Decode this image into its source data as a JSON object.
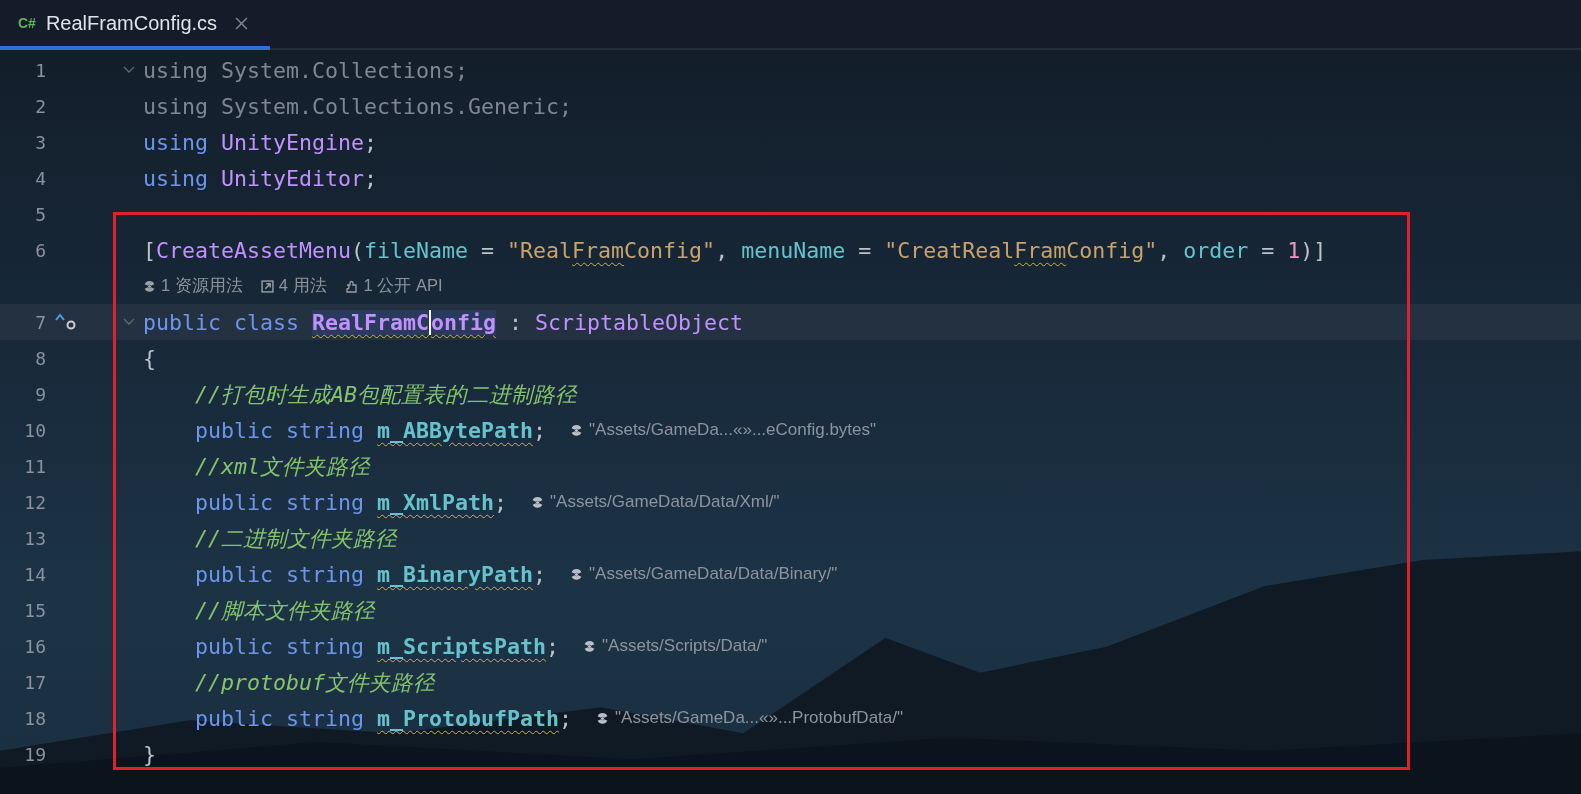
{
  "tabs": [
    {
      "lang": "C#",
      "label": "RealFramConfig.cs",
      "selected": true
    }
  ],
  "lines": [
    {
      "number": "1",
      "foldable": true,
      "framed": false,
      "current": false,
      "gutter_icons": false,
      "tokens": [
        {
          "text": "using System.Collections;",
          "kind": "dim"
        }
      ]
    },
    {
      "number": "2",
      "foldable": false,
      "framed": false,
      "current": false,
      "gutter_icons": false,
      "tokens": [
        {
          "text": "using System.Collections.Generic;",
          "kind": "dim"
        }
      ]
    },
    {
      "number": "3",
      "foldable": false,
      "framed": false,
      "current": false,
      "gutter_icons": false,
      "tokens": [
        {
          "text": "using",
          "kind": "kw"
        },
        {
          "text": " UnityEngine",
          "kind": "type"
        },
        {
          "text": ";",
          "kind": "plain"
        }
      ]
    },
    {
      "number": "4",
      "foldable": false,
      "framed": false,
      "current": false,
      "gutter_icons": false,
      "tokens": [
        {
          "text": "using",
          "kind": "kw"
        },
        {
          "text": " UnityEditor",
          "kind": "type"
        },
        {
          "text": ";",
          "kind": "plain"
        }
      ]
    },
    {
      "number": "5",
      "foldable": false,
      "framed": false,
      "current": false,
      "gutter_icons": false
    },
    {
      "number": "6",
      "foldable": false,
      "framed": true,
      "current": false,
      "gutter_icons": false,
      "tokens": [
        {
          "text": "[",
          "kind": "plain"
        },
        {
          "text": "CreateAssetMenu",
          "kind": "type"
        },
        {
          "text": "(",
          "kind": "plain"
        },
        {
          "text": "fileName",
          "kind": "param"
        },
        {
          "text": " = ",
          "kind": "plain"
        },
        {
          "text": "\"Real",
          "kind": "str"
        },
        {
          "text": "Fram",
          "kind": "str",
          "typo": true
        },
        {
          "text": "Config\"",
          "kind": "str"
        },
        {
          "text": ", ",
          "kind": "plain"
        },
        {
          "text": "menuName",
          "kind": "param"
        },
        {
          "text": " = ",
          "kind": "plain"
        },
        {
          "text": "\"CreatReal",
          "kind": "str"
        },
        {
          "text": "Fram",
          "kind": "str",
          "typo": true
        },
        {
          "text": "Config\"",
          "kind": "str"
        },
        {
          "text": ", ",
          "kind": "plain"
        },
        {
          "text": "order",
          "kind": "param"
        },
        {
          "text": " = ",
          "kind": "plain"
        },
        {
          "text": "1",
          "kind": "num"
        },
        {
          "text": ")]",
          "kind": "plain"
        }
      ],
      "lens": [
        {
          "kind": "resource",
          "text": "1 资源用法"
        },
        {
          "kind": "usages",
          "text": "4 用法"
        },
        {
          "kind": "api",
          "text": "1 公开 API"
        }
      ]
    },
    {
      "number": "7",
      "foldable": true,
      "framed": true,
      "current": true,
      "gutter_icons": true,
      "tokens": [
        {
          "text": "public",
          "kind": "kw"
        },
        {
          "text": " class ",
          "kind": "kw"
        },
        {
          "text": "RealFramC",
          "kind": "cls",
          "typo": true,
          "highlighted": true,
          "caret": true
        },
        {
          "text": "onfig",
          "kind": "cls",
          "typo": true,
          "highlighted": true
        },
        {
          "text": " : ",
          "kind": "plain"
        },
        {
          "text": "ScriptableObject",
          "kind": "type"
        }
      ]
    },
    {
      "number": "8",
      "foldable": false,
      "framed": true,
      "current": false,
      "gutter_icons": false,
      "tokens": [
        {
          "text": "{",
          "kind": "plain"
        }
      ]
    },
    {
      "number": "9",
      "foldable": false,
      "framed": true,
      "current": false,
      "gutter_icons": false,
      "tokens": [
        {
          "text": "    //打包时生成AB包配置表的二进制路径",
          "kind": "cm"
        }
      ]
    },
    {
      "number": "10",
      "foldable": false,
      "framed": true,
      "current": false,
      "gutter_icons": false,
      "tokens": [
        {
          "text": "    public string ",
          "kind": "kw"
        },
        {
          "text": "m_ABBytePath",
          "kind": "field",
          "typo": true
        },
        {
          "text": ";",
          "kind": "plain"
        }
      ],
      "hint": "\"Assets/GameDa...«»...eConfig.bytes\""
    },
    {
      "number": "11",
      "foldable": false,
      "framed": true,
      "current": false,
      "gutter_icons": false,
      "tokens": [
        {
          "text": "    //xml文件夹路径",
          "kind": "cm"
        }
      ]
    },
    {
      "number": "12",
      "foldable": false,
      "framed": true,
      "current": false,
      "gutter_icons": false,
      "tokens": [
        {
          "text": "    public string ",
          "kind": "kw"
        },
        {
          "text": "m_XmlPath",
          "kind": "field",
          "typo": true
        },
        {
          "text": ";",
          "kind": "plain"
        }
      ],
      "hint": "\"Assets/GameData/Data/Xml/\""
    },
    {
      "number": "13",
      "foldable": false,
      "framed": true,
      "current": false,
      "gutter_icons": false,
      "tokens": [
        {
          "text": "    //二进制文件夹路径",
          "kind": "cm"
        }
      ]
    },
    {
      "number": "14",
      "foldable": false,
      "framed": true,
      "current": false,
      "gutter_icons": false,
      "tokens": [
        {
          "text": "    public string ",
          "kind": "kw"
        },
        {
          "text": "m_BinaryPath",
          "kind": "field",
          "typo": true
        },
        {
          "text": ";",
          "kind": "plain"
        }
      ],
      "hint": "\"Assets/GameData/Data/Binary/\""
    },
    {
      "number": "15",
      "foldable": false,
      "framed": true,
      "current": false,
      "gutter_icons": false,
      "tokens": [
        {
          "text": "    //脚本文件夹路径",
          "kind": "cm"
        }
      ]
    },
    {
      "number": "16",
      "foldable": false,
      "framed": true,
      "current": false,
      "gutter_icons": false,
      "tokens": [
        {
          "text": "    public string ",
          "kind": "kw"
        },
        {
          "text": "m_ScriptsPath",
          "kind": "field",
          "typo": true
        },
        {
          "text": ";",
          "kind": "plain"
        }
      ],
      "hint": "\"Assets/Scripts/Data/\""
    },
    {
      "number": "17",
      "foldable": false,
      "framed": true,
      "current": false,
      "gutter_icons": false,
      "tokens": [
        {
          "text": "    //protobuf文件夹路径",
          "kind": "cm"
        }
      ]
    },
    {
      "number": "18",
      "foldable": false,
      "framed": true,
      "current": false,
      "gutter_icons": false,
      "tokens": [
        {
          "text": "    public string ",
          "kind": "kw"
        },
        {
          "text": "m_ProtobufPath",
          "kind": "field",
          "typo": true
        },
        {
          "text": ";",
          "kind": "plain"
        }
      ],
      "hint": "\"Assets/GameDa...«»...ProtobufData/\""
    },
    {
      "number": "19",
      "foldable": false,
      "framed": true,
      "current": false,
      "gutter_icons": false,
      "tokens": [
        {
          "text": "}",
          "kind": "plain"
        }
      ]
    }
  ]
}
